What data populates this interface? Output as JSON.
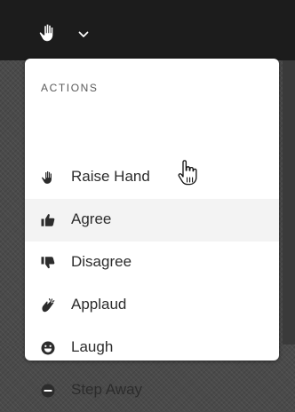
{
  "topbar": {
    "trigger_icon": "raise-hand-icon",
    "chevron_icon": "chevron-down-icon",
    "background": "#1c1c1c"
  },
  "menu": {
    "header": "ACTIONS",
    "hovered_item": "Agree",
    "items": [
      {
        "label": "Raise Hand",
        "icon": "raise-hand-icon"
      },
      {
        "label": "Agree",
        "icon": "thumbs-up-icon"
      },
      {
        "label": "Disagree",
        "icon": "thumbs-down-icon"
      },
      {
        "label": "Applaud",
        "icon": "applaud-icon"
      },
      {
        "label": "Laugh",
        "icon": "laugh-icon"
      },
      {
        "label": "Step Away",
        "icon": "step-away-icon"
      }
    ]
  },
  "colors": {
    "item_text": "#2c2c2c",
    "header_text": "#5a5a5a",
    "hover_background": "#f3f3f3",
    "menu_background": "#ffffff"
  }
}
